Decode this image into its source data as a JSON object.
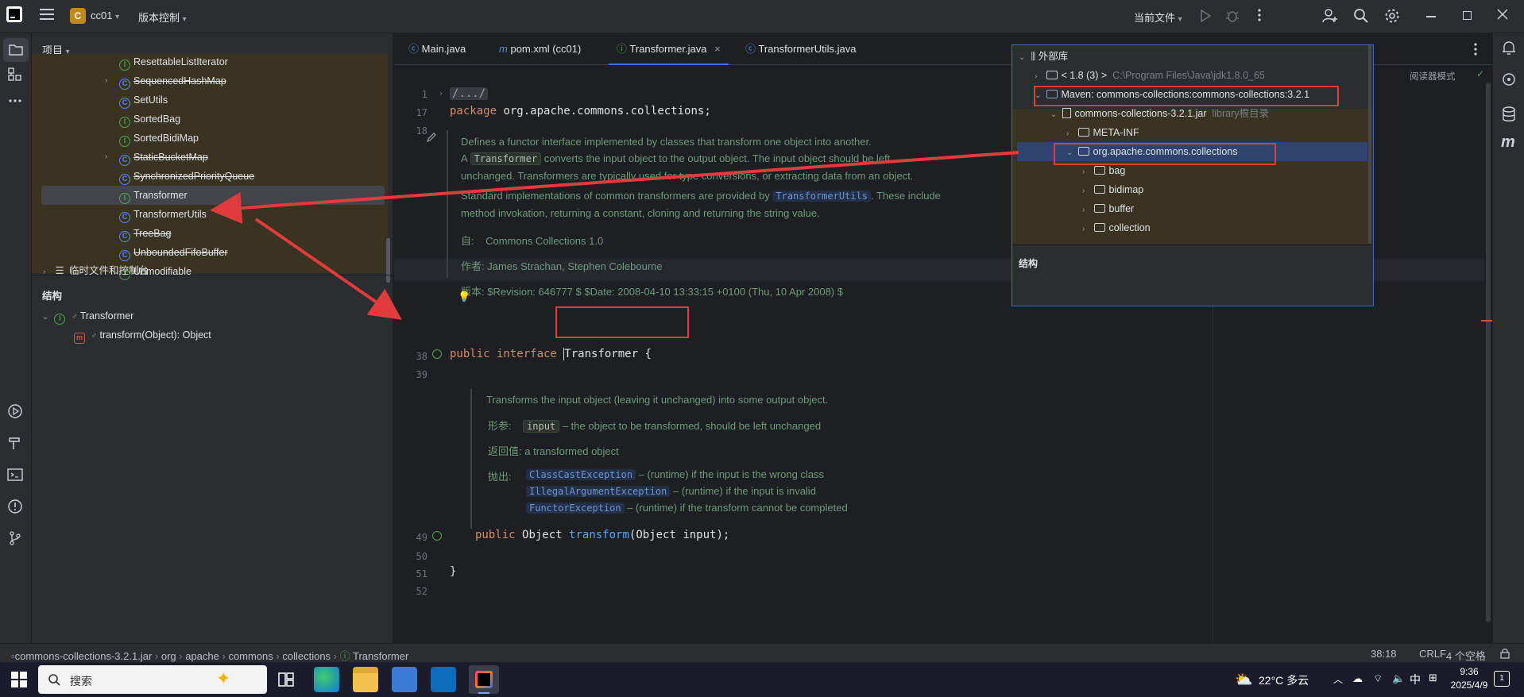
{
  "titlebar": {
    "project_initial": "C",
    "project_name": "cc01",
    "vcs_label": "版本控制",
    "run_config": "当前文件"
  },
  "project_panel": {
    "header": "项目",
    "rows": [
      {
        "label": "ResettableListIterator",
        "kind": "interface",
        "strike": false,
        "expandable": false
      },
      {
        "label": "SequencedHashMap",
        "kind": "class",
        "strike": true,
        "expandable": true
      },
      {
        "label": "SetUtils",
        "kind": "class",
        "strike": false,
        "expandable": false
      },
      {
        "label": "SortedBag",
        "kind": "interface",
        "strike": false,
        "expandable": false
      },
      {
        "label": "SortedBidiMap",
        "kind": "interface",
        "strike": false,
        "expandable": false
      },
      {
        "label": "StaticBucketMap",
        "kind": "class",
        "strike": true,
        "expandable": true
      },
      {
        "label": "SynchronizedPriorityQueue",
        "kind": "class",
        "strike": true,
        "expandable": false
      },
      {
        "label": "Transformer",
        "kind": "interface",
        "strike": false,
        "expandable": false
      },
      {
        "label": "TransformerUtils",
        "kind": "class",
        "strike": false,
        "expandable": false
      },
      {
        "label": "TreeBag",
        "kind": "class",
        "strike": true,
        "expandable": false
      },
      {
        "label": "UnboundedFifoBuffer",
        "kind": "class",
        "strike": true,
        "expandable": false
      },
      {
        "label": "Unmodifiable",
        "kind": "interface",
        "strike": false,
        "expandable": false
      }
    ],
    "scratches": "临时文件和控制台"
  },
  "structure_panel": {
    "header": "结构",
    "root": "Transformer",
    "method": "transform(Object): Object"
  },
  "tabs": [
    {
      "label": "Main.java",
      "active": false
    },
    {
      "label": "pom.xml (cc01)",
      "active": false
    },
    {
      "label": "Transformer.java",
      "active": true
    },
    {
      "label": "TransformerUtils.java",
      "active": false
    }
  ],
  "editor": {
    "reader_mode": "阅读器模式",
    "lines": {
      "l1": "1",
      "l17": "17",
      "l18": "18",
      "l38": "38",
      "l39": "39",
      "l49": "49",
      "l50": "50",
      "l51": "51",
      "l52": "52"
    },
    "folded": "/.../",
    "package_kw": "package",
    "package_name": "org.apache.commons.collections;",
    "doc1_line1": "Defines a functor interface implemented by classes that transform one object into another.",
    "doc1_line2_a": "A",
    "doc1_line2_tag": "Transformer",
    "doc1_line2_b": "converts the input object to the output object. The input object should be left",
    "doc1_line3": "unchanged. Transformers are typically used for type conversions, or extracting data from an object.",
    "doc1_line4_a": "Standard implementations of common transformers are provided by",
    "doc1_line4_link": "TransformerUtils",
    "doc1_line4_b": ". These include",
    "doc1_line5": "method invokation, returning a constant, cloning and returning the string value.",
    "since_label": "自:",
    "since_value": "Commons Collections 1.0",
    "author": "作者: James Strachan, Stephen Colebourne",
    "version": "版本: $Revision: 646777 $ $Date: 2008-04-10 13:33:15 +0100 (Thu, 10 Apr 2008) $",
    "decl_kw": "public interface",
    "decl_name": "Transformer",
    "decl_brace": "{",
    "doc2_line1": "Transforms the input object (leaving it unchanged) into some output object.",
    "param_label": "形参:",
    "param_tag": "input",
    "param_desc": "– the object to be transformed, should be left unchanged",
    "return_label": "返回值:",
    "return_desc": "a transformed object",
    "throws_label": "抛出:",
    "throws": [
      {
        "ex": "ClassCastException",
        "desc": "– (runtime) if the input is the wrong class"
      },
      {
        "ex": "IllegalArgumentException",
        "desc": "– (runtime) if the input is invalid"
      },
      {
        "ex": "FunctorException",
        "desc": "– (runtime) if the transform cannot be completed"
      }
    ],
    "method_kw": "public",
    "method_type": "Object",
    "method_name": "transform",
    "method_params": "(Object input);",
    "close_brace": "}"
  },
  "popup": {
    "root": "外部库",
    "jdk_label": "< 1.8 (3) >",
    "jdk_path": "C:\\Program Files\\Java\\jdk1.8.0_65",
    "maven": "Maven: commons-collections:commons-collections:3.2.1",
    "jar": "commons-collections-3.2.1.jar",
    "jar_hint": "library根目录",
    "meta": "META-INF",
    "pkg": "org.apache.commons.collections",
    "children": [
      "bag",
      "bidimap",
      "buffer",
      "collection"
    ],
    "structure": "结构"
  },
  "statusbar": {
    "crumbs": [
      "commons-collections-3.2.1.jar",
      "org",
      "apache",
      "commons",
      "collections",
      "Transformer"
    ],
    "position": "38:18",
    "line_ending": "CRLF",
    "indent": "4 个空格"
  },
  "taskbar": {
    "search": "搜索",
    "weather": "22°C 多云",
    "ime": "中",
    "time": "9:36",
    "date": "2025/4/9",
    "notif_count": "1"
  },
  "colors": {
    "accent": "#3574f0",
    "annotation_red": "#e03c3c",
    "selection": "#2e436e",
    "doc_text": "#6f9a7a"
  }
}
